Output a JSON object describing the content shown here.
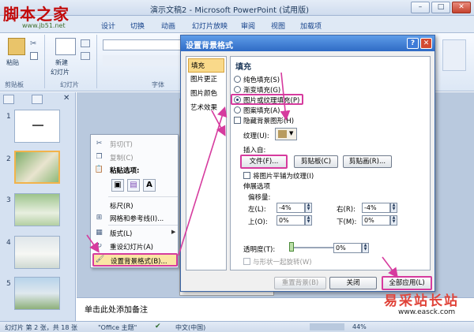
{
  "titlebar": {
    "title": "演示文稿2 - Microsoft PowerPoint (试用版)",
    "min": "–",
    "max": "□",
    "close": "✕"
  },
  "brand": {
    "name": "脚本之家",
    "url": "www.jb51.net"
  },
  "tabs": [
    "设计",
    "切换",
    "动画",
    "幻灯片放映",
    "审阅",
    "视图",
    "加载项"
  ],
  "ribbon": {
    "paste": "粘贴",
    "new_slide": "新建",
    "new_slide2": "幻灯片",
    "clipboard": "剪贴板",
    "slides": "幻灯片",
    "font": "字体"
  },
  "slides_pane": {
    "numbers": [
      "1",
      "2",
      "3",
      "4",
      "5"
    ]
  },
  "context_menu": {
    "cut": "剪切(T)",
    "copy": "复制(C)",
    "paste_options": "粘贴选项:",
    "ruler": "标尺(R)",
    "grid": "网格和参考线(I)...",
    "layout": "版式(L)",
    "reset": "重设幻灯片(A)",
    "format_bg": "设置背景格式(B)...",
    "paste_a": "A"
  },
  "dialog": {
    "title": "设置背景格式",
    "help": "?",
    "close": "✕",
    "nav": [
      "填充",
      "图片更正",
      "图片颜色",
      "艺术效果"
    ],
    "section_fill": "填充",
    "radios": [
      "纯色填充(S)",
      "渐变填充(G)",
      "图片或纹理填充(P)",
      "图案填充(A)"
    ],
    "hide_bg": "隐藏背景图形(H)",
    "texture_label": "纹理(U):",
    "insert_from": "插入自:",
    "file_btn": "文件(F)...",
    "clipboard_btn": "剪贴板(C)",
    "clipart_btn": "剪贴画(R)...",
    "tile": "将图片平铺为纹理(I)",
    "stretch": "伸展选项",
    "offset": "偏移量:",
    "left": "左(L):",
    "right": "右(R):",
    "top": "上(O):",
    "bottom": "下(M):",
    "left_val": "-4%",
    "right_val": "-4%",
    "top_val": "0%",
    "bottom_val": "0%",
    "transparency": "透明度(T):",
    "transparency_val": "0%",
    "rotate": "与形状一起旋转(W)",
    "reset_btn": "重置背景(B)",
    "close_btn": "关闭",
    "apply_all": "全部应用(L)"
  },
  "notes": "单击此处添加备注",
  "statusbar": {
    "slide": "幻灯片 第 2 张，共 18 张",
    "theme": "\"Office 主题\"",
    "lang": "中文(中国)",
    "zoom": "44%"
  },
  "watermark": {
    "name": "易采站长站",
    "url": "www.easck.com"
  },
  "colors": {
    "accent": "#d63b9e",
    "ribbon": "#dce7f5",
    "dialog_title": "#2f6bc5"
  }
}
